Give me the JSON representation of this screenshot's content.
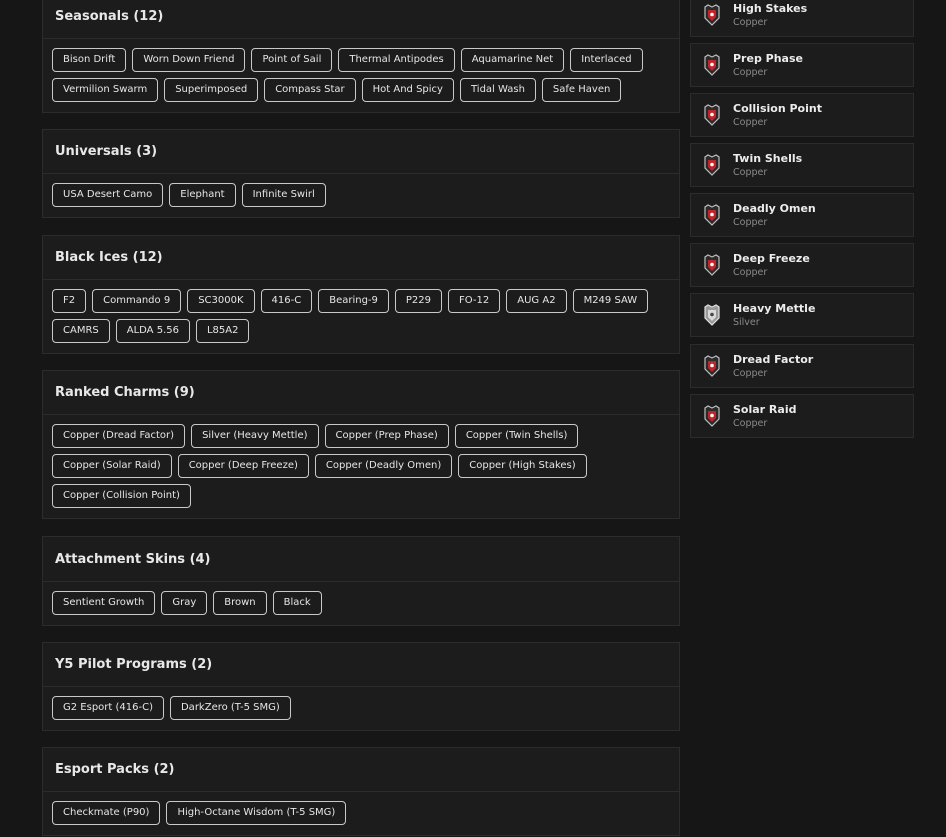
{
  "sections": [
    {
      "title": "Seasonals (12)",
      "items": [
        "Bison Drift",
        "Worn Down Friend",
        "Point of Sail",
        "Thermal Antipodes",
        "Aquamarine Net",
        "Interlaced",
        "Vermilion Swarm",
        "Superimposed",
        "Compass Star",
        "Hot And Spicy",
        "Tidal Wash",
        "Safe Haven"
      ]
    },
    {
      "title": "Universals (3)",
      "items": [
        "USA Desert Camo",
        "Elephant",
        "Infinite Swirl"
      ]
    },
    {
      "title": "Black Ices (12)",
      "items": [
        "F2",
        "Commando 9",
        "SC3000K",
        "416-C",
        "Bearing-9",
        "P229",
        "FO-12",
        "AUG A2",
        "M249 SAW",
        "CAMRS",
        "ALDA 5.56",
        "L85A2"
      ]
    },
    {
      "title": "Ranked Charms (9)",
      "items": [
        "Copper (Dread Factor)",
        "Silver (Heavy Mettle)",
        "Copper (Prep Phase)",
        "Copper (Twin Shells)",
        "Copper (Solar Raid)",
        "Copper (Deep Freeze)",
        "Copper (Deadly Omen)",
        "Copper (High Stakes)",
        "Copper (Collision Point)"
      ]
    },
    {
      "title": "Attachment Skins (4)",
      "items": [
        "Sentient Growth",
        "Gray",
        "Brown",
        "Black"
      ]
    },
    {
      "title": "Y5 Pilot Programs (2)",
      "items": [
        "G2 Esport (416-C)",
        "DarkZero (T-5 SMG)"
      ]
    },
    {
      "title": "Esport Packs (2)",
      "items": [
        "Checkmate (P90)",
        "High-Octane Wisdom (T-5 SMG)"
      ]
    }
  ],
  "charms": [
    {
      "name": "High Stakes",
      "tier": "Copper",
      "icon": "copper-charm-icon",
      "color": "#c0242b"
    },
    {
      "name": "Prep Phase",
      "tier": "Copper",
      "icon": "copper-charm-icon",
      "color": "#c0242b"
    },
    {
      "name": "Collision Point",
      "tier": "Copper",
      "icon": "copper-charm-icon",
      "color": "#c0242b"
    },
    {
      "name": "Twin Shells",
      "tier": "Copper",
      "icon": "copper-charm-icon",
      "color": "#c0242b"
    },
    {
      "name": "Deadly Omen",
      "tier": "Copper",
      "icon": "copper-charm-icon",
      "color": "#c0242b"
    },
    {
      "name": "Deep Freeze",
      "tier": "Copper",
      "icon": "copper-charm-icon",
      "color": "#c0242b"
    },
    {
      "name": "Heavy Mettle",
      "tier": "Silver",
      "icon": "silver-charm-icon",
      "color": "#d8d8d8"
    },
    {
      "name": "Dread Factor",
      "tier": "Copper",
      "icon": "copper-charm-icon",
      "color": "#c0242b"
    },
    {
      "name": "Solar Raid",
      "tier": "Copper",
      "icon": "copper-charm-icon",
      "color": "#c0242b"
    }
  ]
}
